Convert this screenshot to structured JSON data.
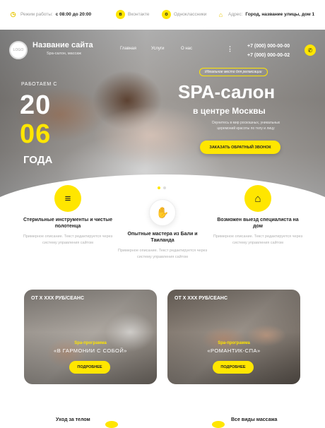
{
  "topbar": {
    "hours_label": "Режим работы:",
    "hours_value": "с 08:00 до 20:00",
    "vk": "Вконтакте",
    "ok": "Одноклассники",
    "address_label": "Адрес:",
    "address_value": "Город, название улицы, дом 1"
  },
  "header": {
    "logo_text": "LOGO",
    "site_name": "Название сайта",
    "site_sub": "Spa-салон, массаж",
    "nav": [
      "Главная",
      "Услуги",
      "О нас"
    ],
    "more": "⋮",
    "phones": [
      "+7 (000) 000-00-00",
      "+7 (000) 000-00-02"
    ]
  },
  "hero": {
    "since": "РАБОТАЕМ С",
    "year_top": "20",
    "year_bottom": "06",
    "year_suffix": "ГОДА",
    "tagline": "Идеальное место для релаксации",
    "title": "SPA-салон",
    "subtitle": "в центре Москвы",
    "desc": "Окунитесь в мир роскошных, уникальных церемоний красоты по телу и лицу",
    "cta": "ЗАКАЗАТЬ ОБРАТНЫЙ ЗВОНОК"
  },
  "features": [
    {
      "icon": "towel-icon",
      "title": "Стерильные инструменты и чистые полотенца",
      "text": "Примерное описание. Текст редактируется через систему управления сайтом"
    },
    {
      "icon": "massage-icon",
      "title": "Опытные мастера из Бали и Таиланда",
      "text": "Примерное описание. Текст редактируется через систему управления сайтом"
    },
    {
      "icon": "home-icon",
      "title": "Возможен выезд специалиста на дом",
      "text": "Примерное описание. Текст редактируется через систему управления сайтом"
    }
  ],
  "programs": [
    {
      "price": "ОТ Х ХХХ РУБ/СЕАНС",
      "kind": "Spa-программа",
      "name": "«В ГАРМОНИИ С СОБОЙ»",
      "button": "ПОДРОБНЕЕ"
    },
    {
      "price": "ОТ Х ХХХ РУБ/СЕАНС",
      "kind": "Spa-программа",
      "name": "«РОМАНТИК-СПА»",
      "button": "ПОДРОБНЕЕ"
    }
  ],
  "bottom": {
    "left_title": "Уход за телом",
    "right_title": "Все виды массажа"
  },
  "colors": {
    "accent": "#ffe600",
    "text": "#222222",
    "muted": "#b0b0b0"
  }
}
